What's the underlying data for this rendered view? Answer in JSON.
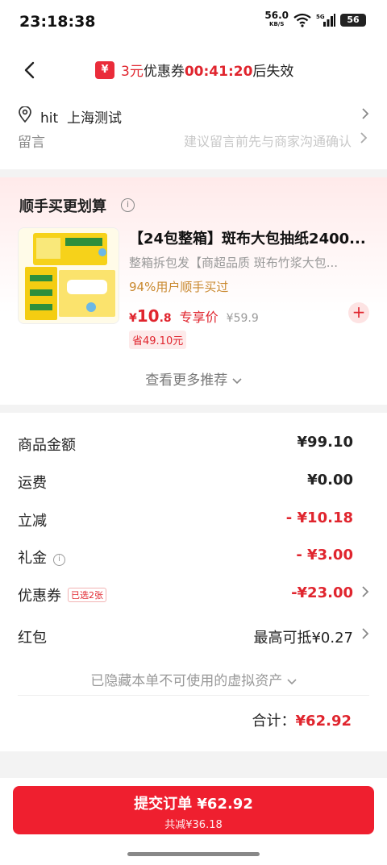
{
  "status_bar": {
    "time": "23:18:38",
    "net_speed": "56.0",
    "net_unit": "KB/S",
    "network": "5G",
    "battery": "56"
  },
  "header": {
    "coupon_amount": "3元",
    "coupon_text": "优惠券",
    "timer": "00:41:20",
    "suffix": "后失效"
  },
  "address": {
    "name": "hit",
    "location": "上海测试"
  },
  "message": {
    "label": "留言",
    "placeholder": "建议留言前先与商家沟通确认"
  },
  "recommend": {
    "title": "顺手买更划算",
    "product": {
      "name": "【24包整箱】斑布大包抽纸2400...",
      "desc": "整箱拆包发【商超品质 斑布竹浆大包...",
      "stat": "94%用户顺手买过",
      "price_int": "10",
      "price_dec": ".8",
      "price_cur": "¥",
      "price_label": "专享价",
      "orig_price": "¥59.9",
      "save": "省49.10元"
    },
    "more": "查看更多推荐"
  },
  "summary": {
    "rows": [
      {
        "label": "商品金额",
        "value": "¥99.10"
      },
      {
        "label": "运费",
        "value": "¥0.00"
      },
      {
        "label": "立减",
        "value": "- ¥10.18"
      },
      {
        "label": "礼金",
        "value": "- ¥3.00"
      },
      {
        "label": "优惠券",
        "tag": "已选2张",
        "value": "-¥23.00"
      },
      {
        "label": "红包",
        "value": "最高可抵¥0.27"
      }
    ],
    "hidden_assets": "已隐藏本单不可使用的虚拟资产",
    "total_label": "合计：",
    "total_value": "¥62.92"
  },
  "submit": {
    "label": "提交订单 ¥62.92",
    "saved": "共减¥36.18"
  },
  "colors": {
    "accent": "#e0252e",
    "button": "#ef1f2f",
    "gold": "#c9882e"
  }
}
